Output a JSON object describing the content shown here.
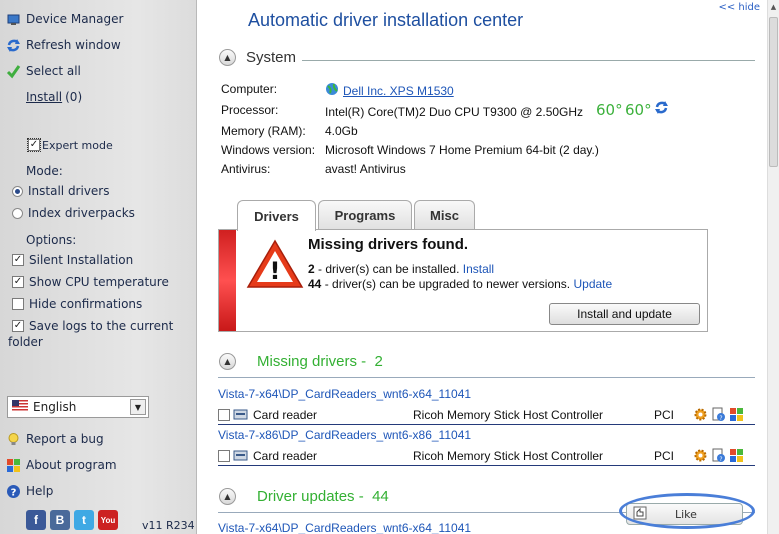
{
  "sidebar": {
    "device_manager": "Device Manager",
    "refresh_window": "Refresh window",
    "select_all": "Select all",
    "install_label": "Install",
    "install_count": "(0)",
    "expert_mode": "Expert mode",
    "mode_label": "Mode:",
    "mode_install": "Install drivers",
    "mode_index": "Index driverpacks",
    "options_label": "Options:",
    "opt_silent": "Silent Installation",
    "opt_cpu_temp": "Show CPU temperature",
    "opt_hide_conf": "Hide confirmations",
    "opt_save_logs_1": "Save logs to the current",
    "opt_save_logs_2": "folder",
    "language": "English",
    "report_bug": "Report a bug",
    "about": "About program",
    "help": "Help",
    "version": "v11 R234",
    "social": [
      "f",
      "B",
      "t",
      "You"
    ]
  },
  "main": {
    "title": "Automatic driver installation center",
    "hide_link": "<< hide",
    "system": {
      "heading": "System",
      "computer_label": "Computer:",
      "computer_value": "Dell Inc. XPS M1530",
      "processor_label": "Processor:",
      "processor_value": "Intel(R) Core(TM)2 Duo CPU T9300 @ 2.50GHz",
      "temp1": "60°",
      "temp2": "60°",
      "memory_label": "Memory (RAM):",
      "memory_value": "4.0Gb",
      "windows_label": "Windows version:",
      "windows_value": "Microsoft Windows 7 Home Premium 64-bit (2 day.)",
      "antivirus_label": "Antivirus:",
      "antivirus_value": "avast! Antivirus"
    },
    "tabs": [
      {
        "label": "Drivers",
        "active": true
      },
      {
        "label": "Programs",
        "active": false
      },
      {
        "label": "Misc",
        "active": false
      }
    ],
    "alert": {
      "title": "Missing drivers found.",
      "line1_count": "2",
      "line1_text": " - driver(s) can be installed. ",
      "line1_link": "Install",
      "line2_count": "44",
      "line2_text": " - driver(s) can be upgraded to newer versions. ",
      "line2_link": "Update",
      "button": "Install and update"
    },
    "missing": {
      "heading": "Missing drivers -",
      "count": "2",
      "items": [
        {
          "path": "Vista-7-x64\\DP_CardReaders_wnt6-x64_11041",
          "type": "Card reader",
          "device": "Ricoh Memory Stick Host Controller",
          "bus": "PCI"
        },
        {
          "path": "Vista-7-x86\\DP_CardReaders_wnt6-x86_11041",
          "type": "Card reader",
          "device": "Ricoh Memory Stick Host Controller",
          "bus": "PCI"
        }
      ]
    },
    "updates": {
      "heading": "Driver updates -",
      "count": "44",
      "first_path": "Vista-7-x64\\DP_CardReaders_wnt6-x64_11041"
    },
    "like": "Like"
  }
}
